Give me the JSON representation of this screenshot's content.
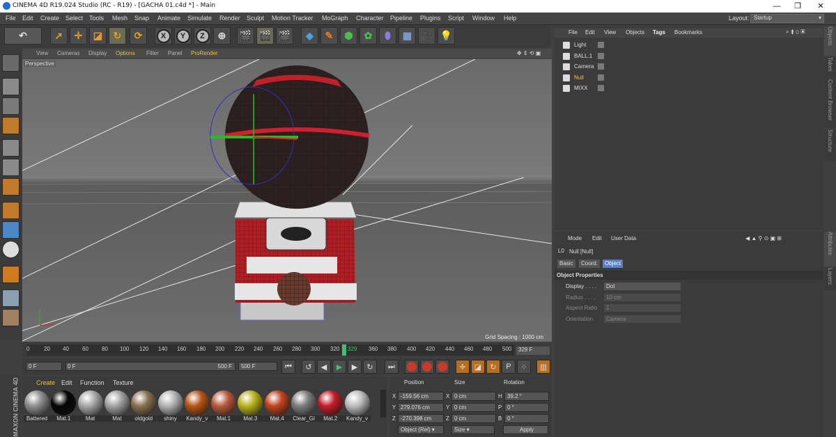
{
  "window": {
    "title": "CINEMA 4D R19.024 Studio (RC - R19) - [GACHA 01.c4d *] - Main",
    "minimize": "—",
    "restore": "❐",
    "close": "✕"
  },
  "menubar": {
    "items": [
      "File",
      "Edit",
      "Create",
      "Select",
      "Tools",
      "Mesh",
      "Snap",
      "Animate",
      "Simulate",
      "Render",
      "Sculpt",
      "Motion Tracker",
      "MoGraph",
      "Character",
      "Pipeline",
      "Plugins",
      "Script",
      "Window",
      "Help"
    ],
    "layout_label": "Layout:",
    "layout_value": "Startup"
  },
  "toolbar": {
    "axis_x": "X",
    "axis_y": "Y",
    "axis_z": "Z"
  },
  "viewport": {
    "menu": [
      "View",
      "Cameras",
      "Display",
      "Options",
      "Filter",
      "Panel",
      "ProRender"
    ],
    "label": "Perspective",
    "grid_spacing": "Grid Spacing : 1000 cm"
  },
  "timeline": {
    "ticks": [
      "0",
      "20",
      "40",
      "60",
      "80",
      "100",
      "120",
      "140",
      "160",
      "180",
      "200",
      "220",
      "240",
      "260",
      "280",
      "300",
      "320",
      "329",
      "360",
      "380",
      "400",
      "420",
      "440",
      "460",
      "480",
      "500"
    ],
    "current_frame": "329",
    "frame_field": "329 F"
  },
  "transport": {
    "start": "0 F",
    "range_start": "0 F",
    "range_end": "500 F",
    "end": "500 F"
  },
  "material_manager": {
    "menu": [
      "Create",
      "Edit",
      "Function",
      "Texture"
    ],
    "materials": [
      {
        "name": "Battered",
        "color": "#8e8e8e"
      },
      {
        "name": "Mat.1",
        "color": "#060606"
      },
      {
        "name": "Mat",
        "color": "#a9a9a9"
      },
      {
        "name": "Mat",
        "color": "#a3a3a3"
      },
      {
        "name": "oldgold",
        "color": "#8a7250"
      },
      {
        "name": "shiny",
        "color": "#b3b3b3"
      },
      {
        "name": "Kandy_v",
        "color": "#b85417"
      },
      {
        "name": "Mat.1",
        "color": "#b85a3c"
      },
      {
        "name": "Mat.3",
        "color": "#b9b41f"
      },
      {
        "name": "Mat.4",
        "color": "#c1441d"
      },
      {
        "name": "Clear_Gl",
        "color": "#7e7e7e"
      },
      {
        "name": "Mat.2",
        "color": "#c21d28"
      },
      {
        "name": "Kandy_v",
        "color": "#bdbdbd"
      }
    ],
    "brand_line1": "MAXON",
    "brand_line2": "CINEMA 4D"
  },
  "coord_manager": {
    "headers": [
      "Position",
      "Size",
      "Rotation"
    ],
    "rows": [
      {
        "axis": "X",
        "pos": "-159.56 cm",
        "size_axis": "X",
        "size": "0 cm",
        "rot_axis": "H",
        "rot": "39.2 °"
      },
      {
        "axis": "Y",
        "pos": "279.076 cm",
        "size_axis": "Y",
        "size": "0 cm",
        "rot_axis": "P",
        "rot": "0 °"
      },
      {
        "axis": "Z",
        "pos": "-270.398 cm",
        "size_axis": "Z",
        "size": "0 cm",
        "rot_axis": "B",
        "rot": "0 °"
      }
    ],
    "mode": "Object (Rel)",
    "size_mode": "Size",
    "apply": "Apply"
  },
  "object_manager": {
    "menu": [
      "File",
      "Edit",
      "View",
      "Objects",
      "Tags",
      "Bookmarks"
    ],
    "objects": [
      {
        "name": "Light"
      },
      {
        "name": "BALL.1"
      },
      {
        "name": "Camera"
      },
      {
        "name": "Null"
      },
      {
        "name": "MIXX"
      }
    ]
  },
  "side_tabs_top": [
    "Objects",
    "Takes",
    "Content Browser",
    "Structure"
  ],
  "side_tabs_bottom": [
    "Attributes",
    "Layers"
  ],
  "attribute_manager": {
    "menu": [
      "Mode",
      "Edit",
      "User Data"
    ],
    "object_title": "Null [Null]",
    "tabs": [
      "Basic",
      "Coord.",
      "Object"
    ],
    "section": "Object Properties",
    "props": [
      {
        "label": "Display . . . .",
        "value": "Dot"
      },
      {
        "label": "Radius . . . .",
        "value": "10 cm"
      },
      {
        "label": "Aspect Ratio",
        "value": "1"
      },
      {
        "label": "Orientation",
        "value": "Camera"
      }
    ]
  }
}
